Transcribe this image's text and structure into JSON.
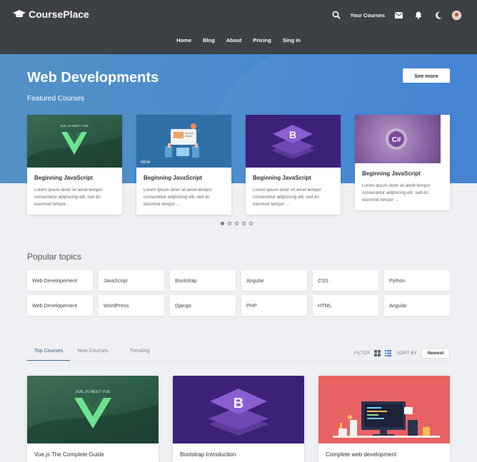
{
  "brand": {
    "name": "CoursePlace"
  },
  "topbar": {
    "your_courses": "Your Courses",
    "icons": [
      "search-icon",
      "mail-icon",
      "bell-icon",
      "moon-icon",
      "avatar"
    ]
  },
  "nav": {
    "items": [
      "Home",
      "Blog",
      "About",
      "Pricing",
      "Sing in"
    ]
  },
  "hero": {
    "title": "Web Developments",
    "subtitle": "Featured Courses",
    "see_more": "See more"
  },
  "featured": [
    {
      "title": "Beginning JavaScript",
      "desc": "Lorem ipsum dolor sit amet tempor consectetur adipiscing elit, sed do eiusmod tempor ...",
      "thumb": "vue"
    },
    {
      "title": "Beginning JavaScript",
      "desc": "Lorem ipsum dolor sit amet tempor consectetur adipiscing elit, sed do eiusmod tempor ...",
      "thumb": "devices"
    },
    {
      "title": "Beginning JavaScript",
      "desc": "Lorem ipsum dolor sit amet tempor consectetur adipiscing elit, sed do eiusmod tempor ...",
      "thumb": "bootstrap"
    },
    {
      "title": "Beginning JavaScript",
      "desc": "Lorem ipsum dolor sit amet tempor consectetur adipiscing elit, sed do eiusmod tempor ...",
      "thumb": "csharp"
    }
  ],
  "carousel": {
    "count": 5,
    "active": 0
  },
  "popular": {
    "title": "Popular topics",
    "row1": [
      "Web Developement",
      "JavaScript",
      "Bootstrap",
      "Angular",
      "CSS",
      "Python"
    ],
    "row2": [
      "Web Developement",
      "WordPress",
      "Django",
      "PHP",
      "HTML",
      "Angular"
    ]
  },
  "tabs": {
    "items": [
      "Top Courses",
      "New Courses",
      "Trending"
    ],
    "active": 0
  },
  "tools": {
    "filter": "FILTER",
    "sort_by": "SORT BY",
    "sort_value": "Newest"
  },
  "courses": [
    {
      "title": "Vue.js The Complete Guide",
      "thumb": "vue"
    },
    {
      "title": "Bootstrap Introduction",
      "thumb": "bootstrap"
    },
    {
      "title": "Complete web development",
      "thumb": "desk"
    }
  ],
  "colors": {
    "topbar": "#3d4045",
    "hero": "#4a8ccd",
    "accent": "#3f6d99",
    "bootstrap": "#563d7c"
  }
}
